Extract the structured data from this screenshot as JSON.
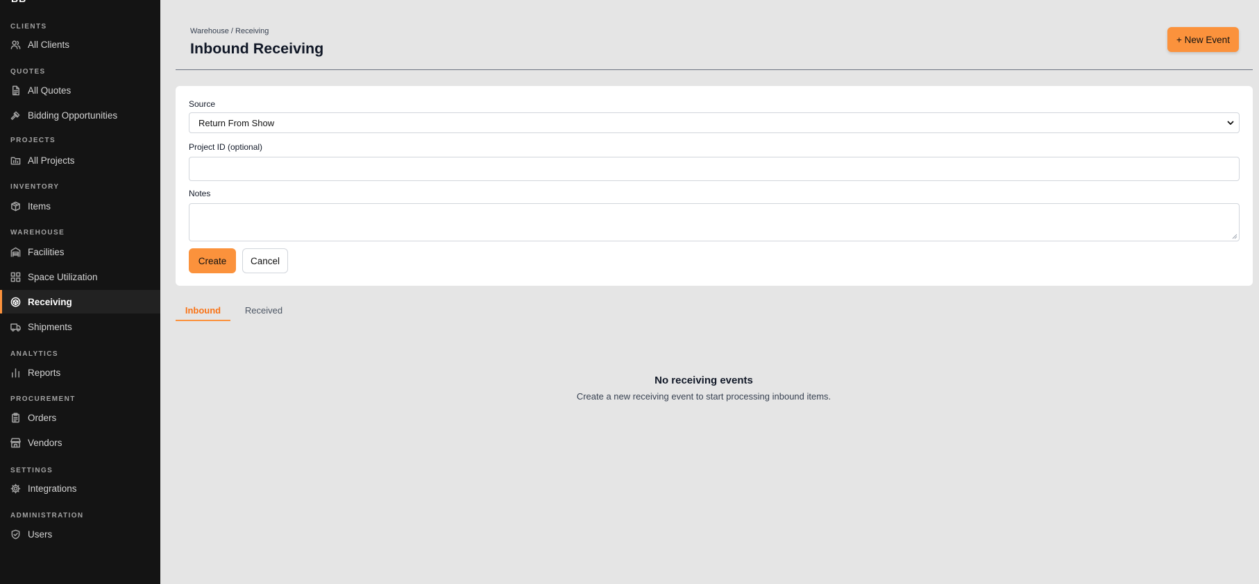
{
  "sidebar": {
    "logo": "BB",
    "sections": [
      {
        "label": "CLIENTS",
        "items": [
          {
            "label": "All Clients",
            "icon": "users-icon"
          }
        ]
      },
      {
        "label": "QUOTES",
        "items": [
          {
            "label": "All Quotes",
            "icon": "document-icon"
          },
          {
            "label": "Bidding Opportunities",
            "icon": "gavel-icon"
          }
        ]
      },
      {
        "label": "PROJECTS",
        "items": [
          {
            "label": "All Projects",
            "icon": "folder-icon"
          }
        ]
      },
      {
        "label": "INVENTORY",
        "items": [
          {
            "label": "Items",
            "icon": "box-icon"
          }
        ]
      },
      {
        "label": "WAREHOUSE",
        "items": [
          {
            "label": "Facilities",
            "icon": "warehouse-icon"
          },
          {
            "label": "Space Utilization",
            "icon": "grid-icon"
          },
          {
            "label": "Receiving",
            "icon": "package-receive-icon"
          },
          {
            "label": "Shipments",
            "icon": "truck-icon"
          }
        ]
      },
      {
        "label": "ANALYTICS",
        "items": [
          {
            "label": "Reports",
            "icon": "bar-chart-icon"
          }
        ]
      },
      {
        "label": "PROCUREMENT",
        "items": [
          {
            "label": "Orders",
            "icon": "clipboard-icon"
          },
          {
            "label": "Vendors",
            "icon": "store-icon"
          }
        ]
      },
      {
        "label": "SETTINGS",
        "items": [
          {
            "label": "Integrations",
            "icon": "gear-icon"
          }
        ]
      },
      {
        "label": "ADMINISTRATION",
        "items": [
          {
            "label": "Users",
            "icon": "shield-icon"
          }
        ]
      }
    ],
    "active_item": "Receiving"
  },
  "header": {
    "breadcrumb": "Warehouse / Receiving",
    "title": "Inbound Receiving",
    "new_event_label": "+ New Event"
  },
  "form": {
    "source_label": "Source",
    "source_value": "Return From Show",
    "project_label": "Project ID (optional)",
    "project_value": "",
    "notes_label": "Notes",
    "notes_value": "",
    "create_label": "Create",
    "cancel_label": "Cancel"
  },
  "tabs": [
    {
      "label": "Inbound",
      "active": true
    },
    {
      "label": "Received",
      "active": false
    }
  ],
  "empty_state": {
    "title": "No receiving events",
    "subtitle": "Create a new receiving event to start processing inbound items."
  },
  "colors": {
    "accent": "#fb923c",
    "sidebar_bg": "#141414",
    "page_bg": "#e5e5e5"
  }
}
